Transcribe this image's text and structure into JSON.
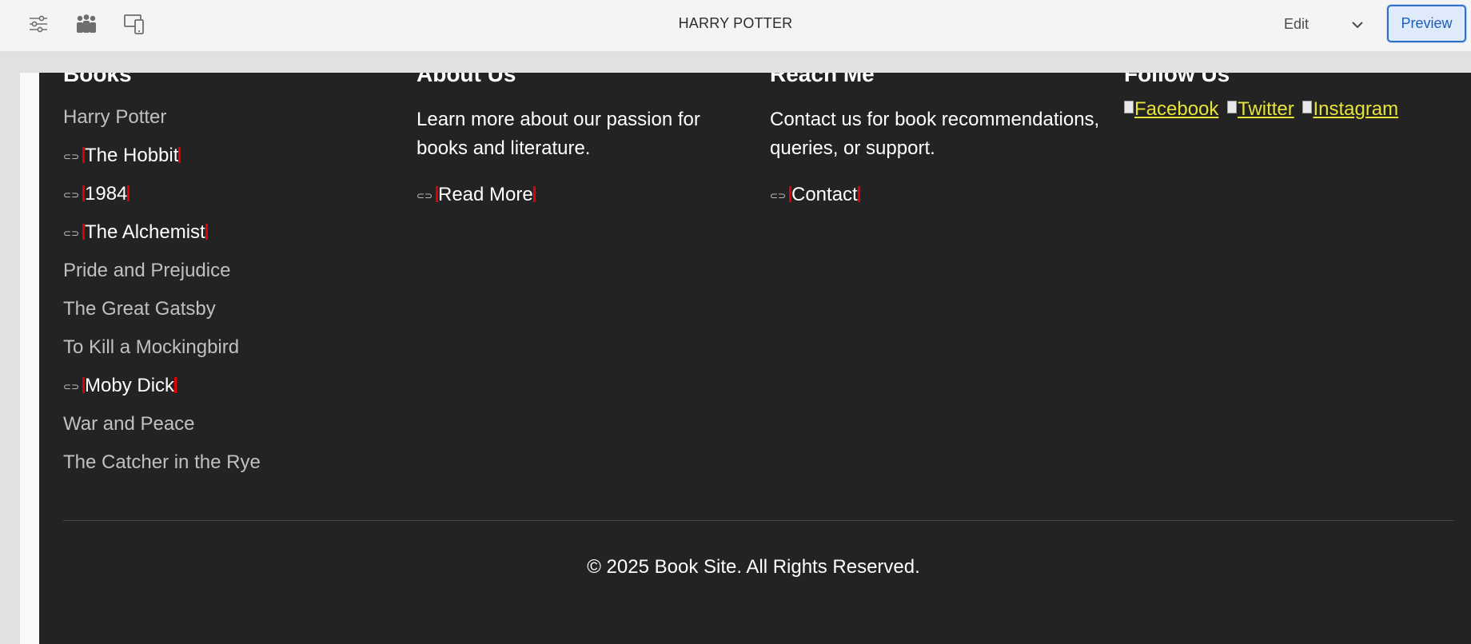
{
  "toolbar": {
    "icons": [
      "sliders-icon",
      "people-icon",
      "device-icon"
    ],
    "page_title": "HARRY POTTER",
    "mode_label": "Edit",
    "preview_label": "Preview",
    "accent_color": "#2f6fc4"
  },
  "footer": {
    "background": "#232323",
    "columns": [
      {
        "heading": "Books",
        "links": [
          {
            "label": "Harry Potter",
            "broken": false
          },
          {
            "label": "The Hobbit",
            "broken": true
          },
          {
            "label": "1984",
            "broken": true
          },
          {
            "label": "The Alchemist",
            "broken": true
          },
          {
            "label": "Pride and Prejudice",
            "broken": false
          },
          {
            "label": "The Great Gatsby",
            "broken": false
          },
          {
            "label": "To Kill a Mockingbird",
            "broken": false
          },
          {
            "label": "Moby Dick",
            "broken": true
          },
          {
            "label": "War and Peace",
            "broken": false
          },
          {
            "label": "The Catcher in the Rye",
            "broken": false
          }
        ]
      },
      {
        "heading": "About Us",
        "text": "Learn more about our passion for books and literature.",
        "link": {
          "label": "Read More",
          "broken": true
        }
      },
      {
        "heading": "Reach Me",
        "text": "Contact us for book recommendations, queries, or support.",
        "link": {
          "label": "Contact",
          "broken": true
        }
      },
      {
        "heading": "Follow Us",
        "social": [
          "Facebook",
          "Twitter",
          "Instagram"
        ],
        "social_color": "#e7e33a"
      }
    ],
    "copyright": "© 2025 Book Site. All Rights Reserved."
  }
}
